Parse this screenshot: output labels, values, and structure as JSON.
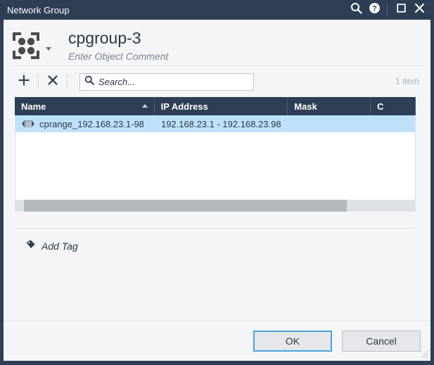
{
  "window": {
    "title": "Network Group",
    "titlebar_actions": [
      {
        "name": "search-icon",
        "label": "Search"
      },
      {
        "name": "help-icon",
        "label": "Help"
      },
      {
        "name": "maximize-icon",
        "label": "Maximize"
      },
      {
        "name": "close-icon",
        "label": "Close"
      }
    ]
  },
  "object": {
    "icon": "network-group-icon",
    "name": "cpgroup-3",
    "comment_placeholder": "Enter Object Comment"
  },
  "toolbar": {
    "add_label": "+",
    "remove_label": "×",
    "search": {
      "value": "",
      "placeholder": "Search..."
    },
    "item_count": "1 item"
  },
  "table": {
    "columns": [
      {
        "label": "Name",
        "sorted": "asc"
      },
      {
        "label": "IP Address",
        "sorted": ""
      },
      {
        "label": "Mask",
        "sorted": ""
      },
      {
        "label": "C",
        "sorted": ""
      }
    ],
    "rows": [
      {
        "icon": "address-range-icon",
        "name": "cprange_192.168.23.1-98",
        "ip_address": "192.168.23.1 - 192.168.23.98",
        "mask": "",
        "comments": "",
        "selected": true
      }
    ]
  },
  "tags": {
    "add_label": "Add Tag",
    "icon": "tag-icon"
  },
  "footer": {
    "ok_label": "OK",
    "cancel_label": "Cancel"
  },
  "colors": {
    "titlebar": "#2e3e55",
    "header_row": "#2e3e55",
    "selection": "#bfe2fa",
    "accent_focus": "#4aa3df",
    "panel": "#f4f5f6",
    "muted_text": "#aab4c4"
  }
}
